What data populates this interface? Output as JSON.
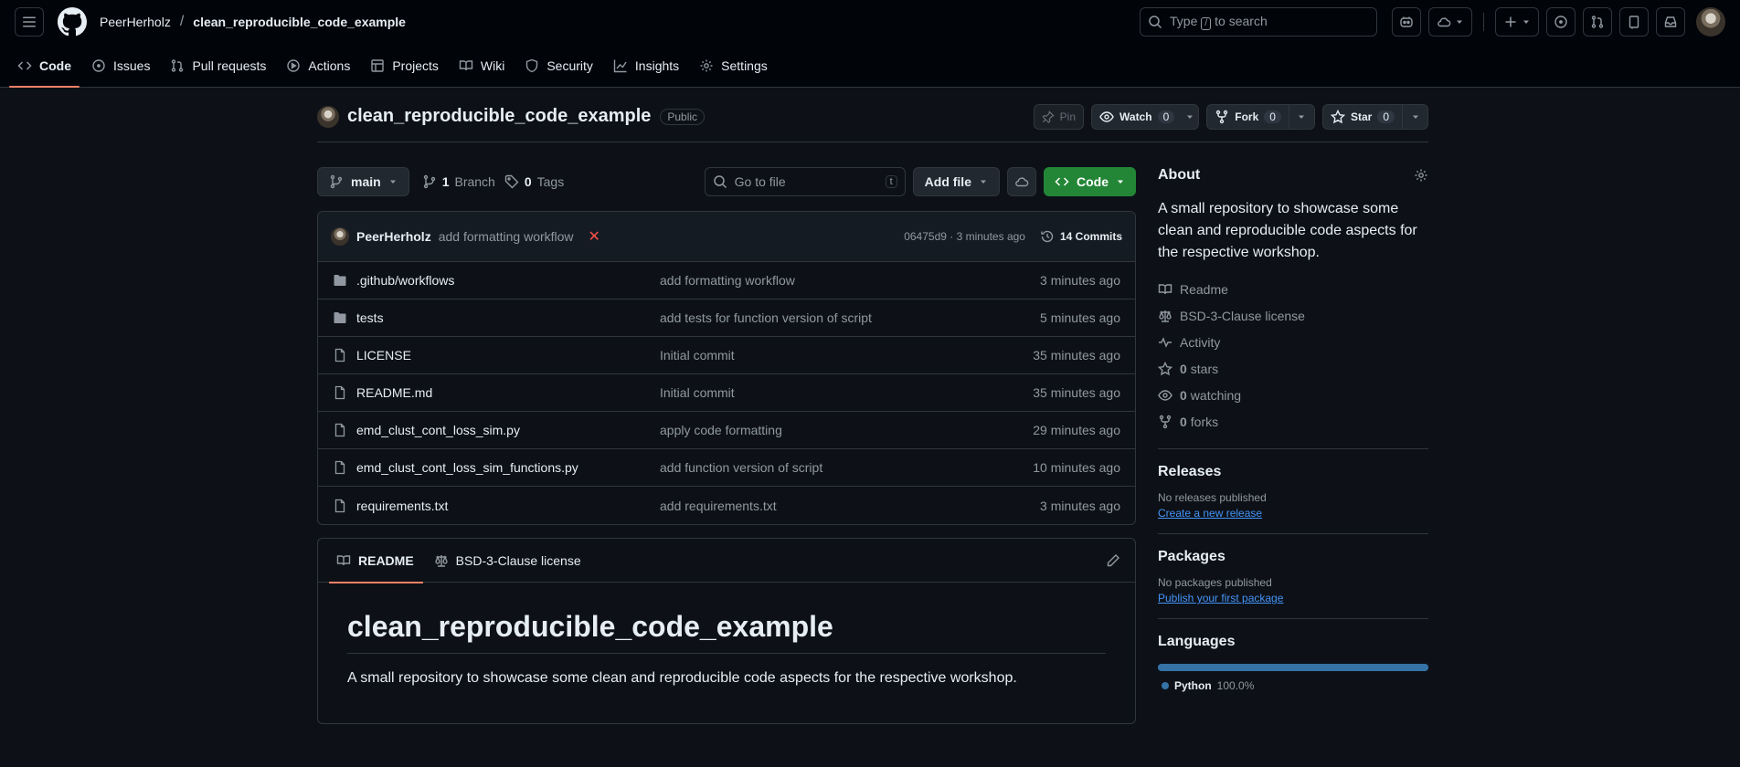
{
  "header": {
    "owner": "PeerHerholz",
    "separator": "/",
    "repo": "clean_reproducible_code_example",
    "search_prefix": "Type",
    "search_key": "/",
    "search_suffix": "to search"
  },
  "nav": {
    "tabs": [
      {
        "label": "Code",
        "icon": "code-icon"
      },
      {
        "label": "Issues",
        "icon": "issue-icon"
      },
      {
        "label": "Pull requests",
        "icon": "pull-request-icon"
      },
      {
        "label": "Actions",
        "icon": "play-icon"
      },
      {
        "label": "Projects",
        "icon": "table-icon"
      },
      {
        "label": "Wiki",
        "icon": "book-icon"
      },
      {
        "label": "Security",
        "icon": "shield-icon"
      },
      {
        "label": "Insights",
        "icon": "graph-icon"
      },
      {
        "label": "Settings",
        "icon": "gear-icon"
      }
    ]
  },
  "repo": {
    "title": "clean_reproducible_code_example",
    "visibility": "Public",
    "pin": "Pin",
    "watch": {
      "label": "Watch",
      "count": "0"
    },
    "fork": {
      "label": "Fork",
      "count": "0"
    },
    "star": {
      "label": "Star",
      "count": "0"
    }
  },
  "toolbar": {
    "branch": "main",
    "branch_count": "1",
    "branch_label": "Branch",
    "tag_count": "0",
    "tag_label": "Tags",
    "goto_placeholder": "Go to file",
    "goto_key": "t",
    "add_file": "Add file",
    "code": "Code"
  },
  "latest_commit": {
    "author": "PeerHerholz",
    "message": "add formatting workflow",
    "status": "✕",
    "sha_time": "06475d9 · 3 minutes ago",
    "commits": "14 Commits"
  },
  "files": [
    {
      "type": "dir",
      "name": ".github/workflows",
      "message": "add formatting workflow",
      "date": "3 minutes ago"
    },
    {
      "type": "dir",
      "name": "tests",
      "message": "add tests for function version of script",
      "date": "5 minutes ago"
    },
    {
      "type": "file",
      "name": "LICENSE",
      "message": "Initial commit",
      "date": "35 minutes ago"
    },
    {
      "type": "file",
      "name": "README.md",
      "message": "Initial commit",
      "date": "35 minutes ago"
    },
    {
      "type": "file",
      "name": "emd_clust_cont_loss_sim.py",
      "message": "apply code formatting",
      "date": "29 minutes ago"
    },
    {
      "type": "file",
      "name": "emd_clust_cont_loss_sim_functions.py",
      "message": "add function version of script",
      "date": "10 minutes ago"
    },
    {
      "type": "file",
      "name": "requirements.txt",
      "message": "add requirements.txt",
      "date": "3 minutes ago"
    }
  ],
  "readme": {
    "tab_readme": "README",
    "tab_license": "BSD-3-Clause license",
    "heading": "clean_reproducible_code_example",
    "body": "A small repository to showcase some clean and reproducible code aspects for the respective workshop."
  },
  "sidebar": {
    "about_title": "About",
    "about_desc": "A small repository to showcase some clean and reproducible code aspects for the respective workshop.",
    "readme": "Readme",
    "license": "BSD-3-Clause license",
    "activity": "Activity",
    "stars_count": "0",
    "stars_label": "stars",
    "watching_count": "0",
    "watching_label": "watching",
    "forks_count": "0",
    "forks_label": "forks",
    "releases_title": "Releases",
    "releases_none": "No releases published",
    "releases_link": "Create a new release",
    "packages_title": "Packages",
    "packages_none": "No packages published",
    "packages_link": "Publish your first package",
    "languages_title": "Languages",
    "language_name": "Python",
    "language_pct": "100.0%",
    "language_share": 1.0,
    "language_color": "#3572a5"
  },
  "colors": {
    "accent_green": "#238636",
    "tab_underline": "#f78166",
    "link": "#4493f8",
    "failure": "#f85149"
  }
}
